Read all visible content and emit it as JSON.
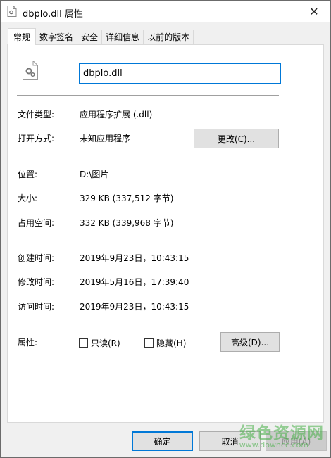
{
  "window": {
    "title": "dbplo.dll 属性",
    "close_glyph": "✕"
  },
  "tabs": [
    "常规",
    "数字签名",
    "安全",
    "详细信息",
    "以前的版本"
  ],
  "general": {
    "filename": "dbplo.dll",
    "type_label": "文件类型:",
    "type_value": "应用程序扩展 (.dll)",
    "open_label": "打开方式:",
    "open_value": "未知应用程序",
    "change_button": "更改(C)...",
    "location_label": "位置:",
    "location_value": "D:\\图片",
    "size_label": "大小:",
    "size_value": "329 KB (337,512 字节)",
    "disk_label": "占用空间:",
    "disk_value": "332 KB (339,968 字节)",
    "created_label": "创建时间:",
    "created_value": "2019年9月23日，10:43:15",
    "modified_label": "修改时间:",
    "modified_value": "2019年5月16日，17:39:40",
    "accessed_label": "访问时间:",
    "accessed_value": "2019年9月23日，10:43:15",
    "attributes_label": "属性:",
    "readonly_label": "只读(R)",
    "hidden_label": "隐藏(H)",
    "advanced_button": "高级(D)..."
  },
  "footer": {
    "ok": "确定",
    "cancel": "取消",
    "apply": "应用(A)"
  },
  "watermark": {
    "line1": "绿色资源网",
    "line2": "www.downcc.com"
  },
  "colors": {
    "accent": "#0078d7",
    "watermark": "#46af46"
  }
}
